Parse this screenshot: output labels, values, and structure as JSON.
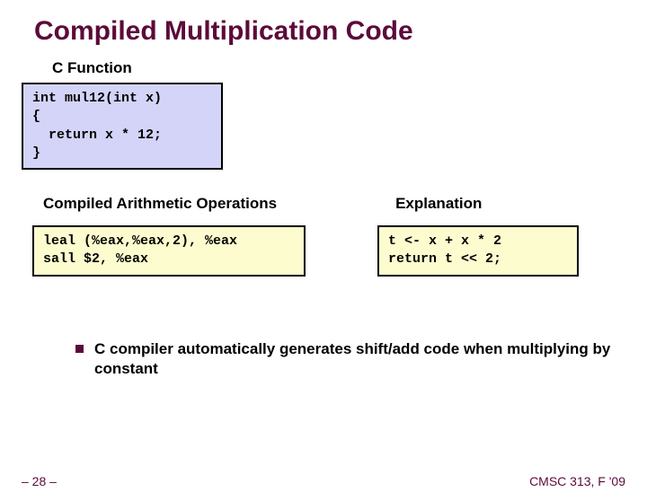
{
  "title": "Compiled Multiplication Code",
  "section_c": "C Function",
  "code_c": "int mul12(int x)\n{\n  return x * 12;\n}",
  "section_asm": "Compiled Arithmetic Operations",
  "section_expl": "Explanation",
  "code_asm": "leal (%eax,%eax,2), %eax\nsall $2, %eax",
  "code_expl": "t <- x + x * 2\nreturn t << 2;",
  "bullet": "C compiler automatically generates shift/add code when multiplying by constant",
  "footer_left": "– 28 –",
  "footer_right": "CMSC 313, F '09"
}
